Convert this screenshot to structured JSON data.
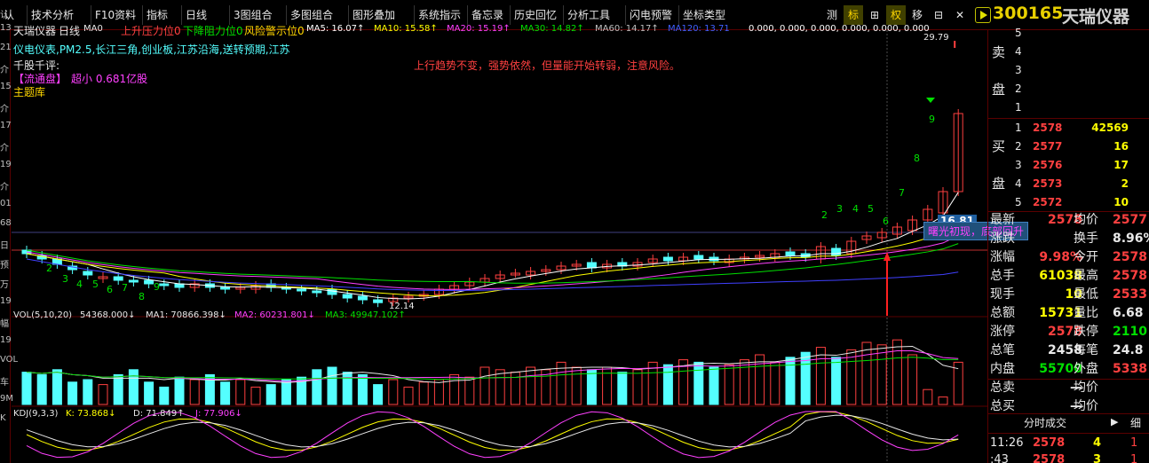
{
  "toolbar": {
    "items": [
      "认",
      "技术分析",
      "F10资料",
      "指标",
      "日线",
      "3图组合",
      "多图组合",
      "图形叠加",
      "系统指示",
      "备忘录",
      "历史回忆",
      "分析工具",
      "闪电预警",
      "坐标类型"
    ],
    "right_items": [
      "测",
      "标",
      "⊞",
      "权",
      "移",
      "⊟",
      "✕"
    ],
    "stock_code": "300165",
    "stock_name": "天瑞仪器"
  },
  "left_scale": [
    "认",
    "13",
    "21",
    "介",
    "15",
    "介",
    "17",
    "介",
    "19",
    "介",
    "01",
    "68",
    "日",
    "预",
    "万",
    "19",
    "幅",
    "19",
    "VOL",
    "车",
    "9M",
    "K"
  ],
  "chart": {
    "header": {
      "name": "天瑞仪器",
      "period": "日线",
      "ma0": "MA0",
      "resist": "上升压力位0",
      "support": "下降阻力位0",
      "risk": "风险警示位0",
      "ma5": "MA5: 16.07↑",
      "ma10": "MA10: 15.58↑",
      "ma20": "MA20: 15.19↑",
      "ma30": "MA30: 14.82↑",
      "ma60": "MA60: 14.17↑",
      "ma120": "MA120: 13.71",
      "tail": "0.000, 0.000, 0.000, 0.000, 0.000, 0.000"
    },
    "info_lines": [
      "仪电仪表,PM2.5,长江三角,创业板,江苏沿海,送转预期,江苏",
      "千股千评:",
      "主题库"
    ],
    "float_cap_label": "【流通盘】",
    "float_cap_value": "超小 0.681亿股",
    "comment": "上行趋势不变，强势依然，但量能开始转弱，注意风险。",
    "price_tag": "16.81",
    "signal_text": "曙光初现，底部回升",
    "low_label": "12.14",
    "high_label": "29.79",
    "vol_header": {
      "name": "VOL(5,10,20)",
      "v": "54368.000↓",
      "ma1": "MA1: 70866.398↓",
      "ma2": "MA2: 60231.801↓",
      "ma3": "MA3: 49947.102↑"
    },
    "kdj_header": {
      "name": "KDJ(9,3,3)",
      "k": "K: 73.868↓",
      "d": "D: 71.849↑",
      "j": "J: 77.906↓"
    },
    "seq_labels_low": [
      "2",
      "3",
      "4",
      "5",
      "6",
      "7",
      "8",
      "9"
    ],
    "seq_labels_high": [
      "2",
      "3",
      "4",
      "5",
      "6",
      "7",
      "8",
      "9"
    ]
  },
  "orderbook": {
    "sell_label": [
      "卖",
      "盘"
    ],
    "buy_label": [
      "买",
      "盘"
    ],
    "sell": [
      {
        "lvl": "5",
        "px": "",
        "vol": ""
      },
      {
        "lvl": "4",
        "px": "",
        "vol": ""
      },
      {
        "lvl": "3",
        "px": "",
        "vol": ""
      },
      {
        "lvl": "2",
        "px": "",
        "vol": ""
      },
      {
        "lvl": "1",
        "px": "",
        "vol": ""
      }
    ],
    "buy": [
      {
        "lvl": "1",
        "px": "2578",
        "vol": "42569"
      },
      {
        "lvl": "2",
        "px": "2577",
        "vol": "16"
      },
      {
        "lvl": "3",
        "px": "2576",
        "vol": "17"
      },
      {
        "lvl": "4",
        "px": "2573",
        "vol": "2"
      },
      {
        "lvl": "5",
        "px": "2572",
        "vol": "10"
      }
    ]
  },
  "stats": [
    {
      "k1": "最新",
      "v1": "2578",
      "c1": "red",
      "k2": "均价",
      "v2": "2577",
      "c2": "red"
    },
    {
      "k1": "涨跌",
      "v1": "",
      "c1": "red",
      "k2": "换手",
      "v2": "8.96%",
      "c2": "wht"
    },
    {
      "k1": "涨幅",
      "v1": "9.98%",
      "c1": "red",
      "k2": "今开",
      "v2": "2578",
      "c2": "red"
    },
    {
      "k1": "总手",
      "v1": "61038",
      "c1": "yel",
      "k2": "最高",
      "v2": "2578",
      "c2": "red"
    },
    {
      "k1": "现手",
      "v1": "10",
      "c1": "yel",
      "k2": "最低",
      "v2": "2533",
      "c2": "red"
    },
    {
      "k1": "总额",
      "v1": "15731",
      "c1": "yel",
      "k2": "量比",
      "v2": "6.68",
      "c2": "wht"
    },
    {
      "k1": "涨停",
      "v1": "2578",
      "c1": "red",
      "k2": "跌停",
      "v2": "2110",
      "c2": "grn"
    },
    {
      "k1": "总笔",
      "v1": "2458",
      "c1": "wht",
      "k2": "每笔",
      "v2": "24.8",
      "c2": "wht"
    },
    {
      "k1": "内盘",
      "v1": "55700",
      "c1": "grn",
      "k2": "外盘",
      "v2": "5338",
      "c2": "red"
    },
    {
      "k1": "总卖",
      "v1": "—",
      "c1": "wht",
      "k2": "均价",
      "v2": "",
      "c2": "wht"
    },
    {
      "k1": "总买",
      "v1": "—",
      "c1": "wht",
      "k2": "均价",
      "v2": "",
      "c2": "wht"
    }
  ],
  "tabs": {
    "left": "分时成交",
    "right": "细"
  },
  "ticks": [
    {
      "time": "11:26",
      "px": "2578",
      "vol": "4",
      "flag": "1"
    },
    {
      "time": ":43",
      "px": "2578",
      "vol": "3",
      "flag": "1"
    }
  ],
  "colors": {
    "up": "#ff4040",
    "down": "#54ffff",
    "ma5": "#ffffff",
    "ma10": "#ffff00",
    "ma20": "#ff40ff",
    "ma30": "#00e000",
    "ma60": "#4040ff",
    "bg": "#000000"
  }
}
